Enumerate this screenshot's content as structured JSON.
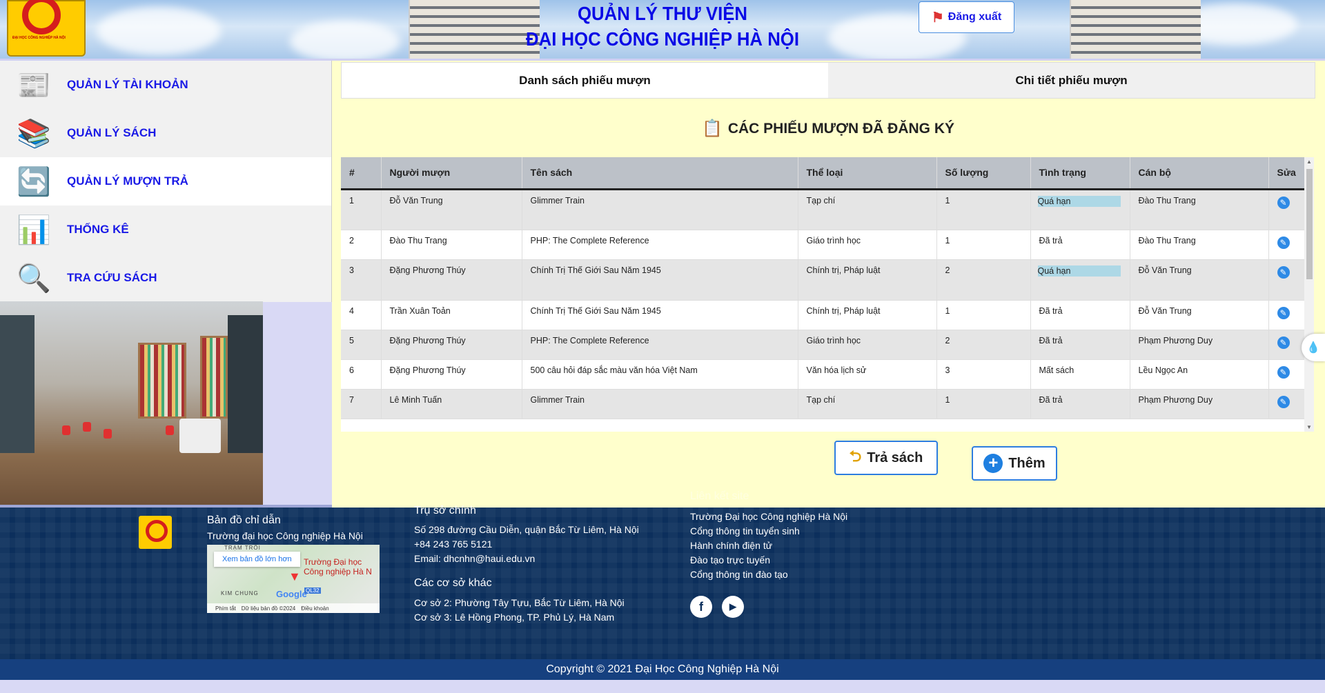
{
  "header": {
    "title_line1": "QUẢN LÝ THƯ VIỆN",
    "title_line2": "ĐẠI HỌC CÔNG NGHIỆP HÀ NỘI",
    "logo_text": "ĐẠI HỌC CÔNG NGHIỆP HÀ NỘI",
    "logout_label": "Đăng xuất"
  },
  "sidebar": {
    "items": [
      {
        "label": "QUẢN LÝ TÀI KHOẢN",
        "icon": "reader-icon",
        "glyph": "📰",
        "active": false
      },
      {
        "label": "QUẢN LÝ SÁCH",
        "icon": "books-icon",
        "glyph": "📚",
        "active": false
      },
      {
        "label": "QUẢN LÝ MƯỢN TRẢ",
        "icon": "exchange-icon",
        "glyph": "🔄",
        "active": true
      },
      {
        "label": "THỐNG KÊ",
        "icon": "chart-magnifier-icon",
        "glyph": "📊",
        "active": false
      },
      {
        "label": "TRA CỨU SÁCH",
        "icon": "search-icon",
        "glyph": "🔍",
        "active": false
      }
    ]
  },
  "tabs": [
    {
      "label": "Danh sách phiếu mượn",
      "active": true
    },
    {
      "label": "Chi tiết phiếu mượn",
      "active": false
    }
  ],
  "main": {
    "heading": "CÁC PHIẾU MƯỢN ĐÃ ĐĂNG KÝ",
    "columns": [
      "#",
      "Người mượn",
      "Tên sách",
      "Thể loại",
      "Số lượng",
      "Tình trạng",
      "Cán bộ",
      "Sửa"
    ],
    "rows": [
      [
        "1",
        "Đỗ Văn Trung",
        "Glimmer Train",
        "Tạp chí",
        "1",
        "Quá hạn",
        "Đào Thu Trang"
      ],
      [
        "2",
        "Đào Thu Trang",
        "PHP: The Complete Reference",
        "Giáo trình học",
        "1",
        "Đã trả",
        "Đào Thu Trang"
      ],
      [
        "3",
        "Đặng Phương Thúy",
        "Chính Trị Thế Giới Sau Năm 1945",
        "Chính trị, Pháp luật",
        "2",
        "Quá hạn",
        "Đỗ Văn Trung"
      ],
      [
        "4",
        "Trần Xuân Toản",
        "Chính Trị Thế Giới Sau Năm 1945",
        "Chính trị, Pháp luật",
        "1",
        "Đã trả",
        "Đỗ Văn Trung"
      ],
      [
        "5",
        "Đặng Phương Thúy",
        "PHP: The Complete Reference",
        "Giáo trình học",
        "2",
        "Đã trả",
        "Phạm Phương Duy"
      ],
      [
        "6",
        "Đặng Phương Thúy",
        "500 câu hỏi đáp sắc màu văn hóa Việt Nam",
        "Văn hóa lịch sử",
        "3",
        "Mất sách",
        "Lều Ngọc An"
      ],
      [
        "7",
        "Lê Minh Tuấn",
        "Glimmer Train",
        "Tạp chí",
        "1",
        "Đã trả",
        "Phạm Phương Duy"
      ]
    ],
    "overdue_status": "Quá hạn",
    "overdue_color": "#add8e6",
    "return_label": "Trả sách",
    "add_label": "Thêm"
  },
  "footer": {
    "map_title": "Bản đồ chỉ dẫn",
    "map_subtitle": "Trường đại học Công nghiệp Hà Nội",
    "map_button": "Xem bản đồ lớn hơn",
    "map_place": "Trường Đại học Công nghiệp Hà N",
    "map_label_top": "TRẠM TRÔI",
    "map_label_bottom": "KIM CHUNG",
    "map_road": "QL32",
    "map_brand": "Google",
    "map_bar": [
      "Phím tắt",
      "Dữ liệu bản đồ ©2024",
      "Điều khoản"
    ],
    "hq_title": "Trụ sở chính",
    "hq_address": "Số 298 đường Cầu Diễn, quận Bắc Từ Liêm, Hà Nội",
    "hq_phone": "+84 243 765 5121",
    "hq_email": "Email: dhcnhn@haui.edu.vn",
    "other_title": "Các cơ sở khác",
    "other_1": "Cơ sở 2: Phường Tây Tựu, Bắc Từ Liêm, Hà Nội",
    "other_2": "Cơ sở 3: Lê Hồng Phong, TP. Phủ Lý, Hà Nam",
    "links_title": "Liên kết site",
    "links": [
      "Trường Đại học Công nghiệp Hà Nội",
      "Cổng thông tin tuyển sinh",
      "Hành chính điện tử",
      "Đào tạo trực tuyến",
      "Cổng thông tin đào tạo"
    ],
    "copyright": "Copyright © 2021 Đại Học Công Nghiệp Hà Nội"
  }
}
